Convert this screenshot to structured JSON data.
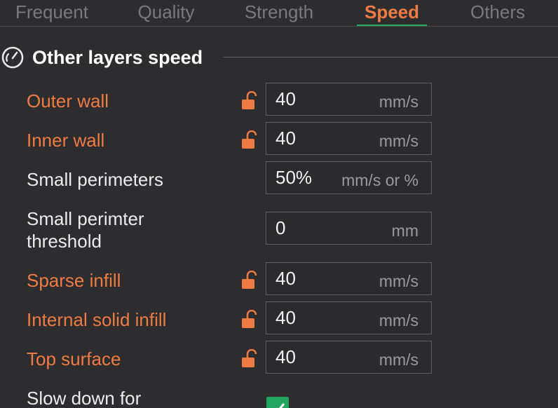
{
  "tabs": [
    {
      "label": "Frequent"
    },
    {
      "label": "Quality"
    },
    {
      "label": "Strength"
    },
    {
      "label": "Speed"
    },
    {
      "label": "Others"
    }
  ],
  "section": {
    "title": "Other layers speed",
    "icon": "gauge-icon"
  },
  "rows": [
    {
      "label": "Outer wall",
      "value": "40",
      "unit": "mm/s",
      "modified": true
    },
    {
      "label": "Inner wall",
      "value": "40",
      "unit": "mm/s",
      "modified": true
    },
    {
      "label": "Small perimeters",
      "value": "50%",
      "unit": "mm/s or %",
      "modified": false
    },
    {
      "label_line1": "Small perimter",
      "label_line2": "threshold",
      "value": "0",
      "unit": "mm",
      "modified": false
    },
    {
      "label": "Sparse infill",
      "value": "40",
      "unit": "mm/s",
      "modified": true
    },
    {
      "label": "Internal solid infill",
      "value": "40",
      "unit": "mm/s",
      "modified": true
    },
    {
      "label": "Top surface",
      "value": "40",
      "unit": "mm/s",
      "modified": true
    },
    {
      "label": "Slow down for",
      "checked": true
    }
  ],
  "colors": {
    "modified_text": "#ee7b44",
    "active_tab_text": "#ee7b44",
    "active_tab_underline": "#1fad65",
    "checkbox": "#23a55f",
    "background": "#2d2d2f"
  }
}
